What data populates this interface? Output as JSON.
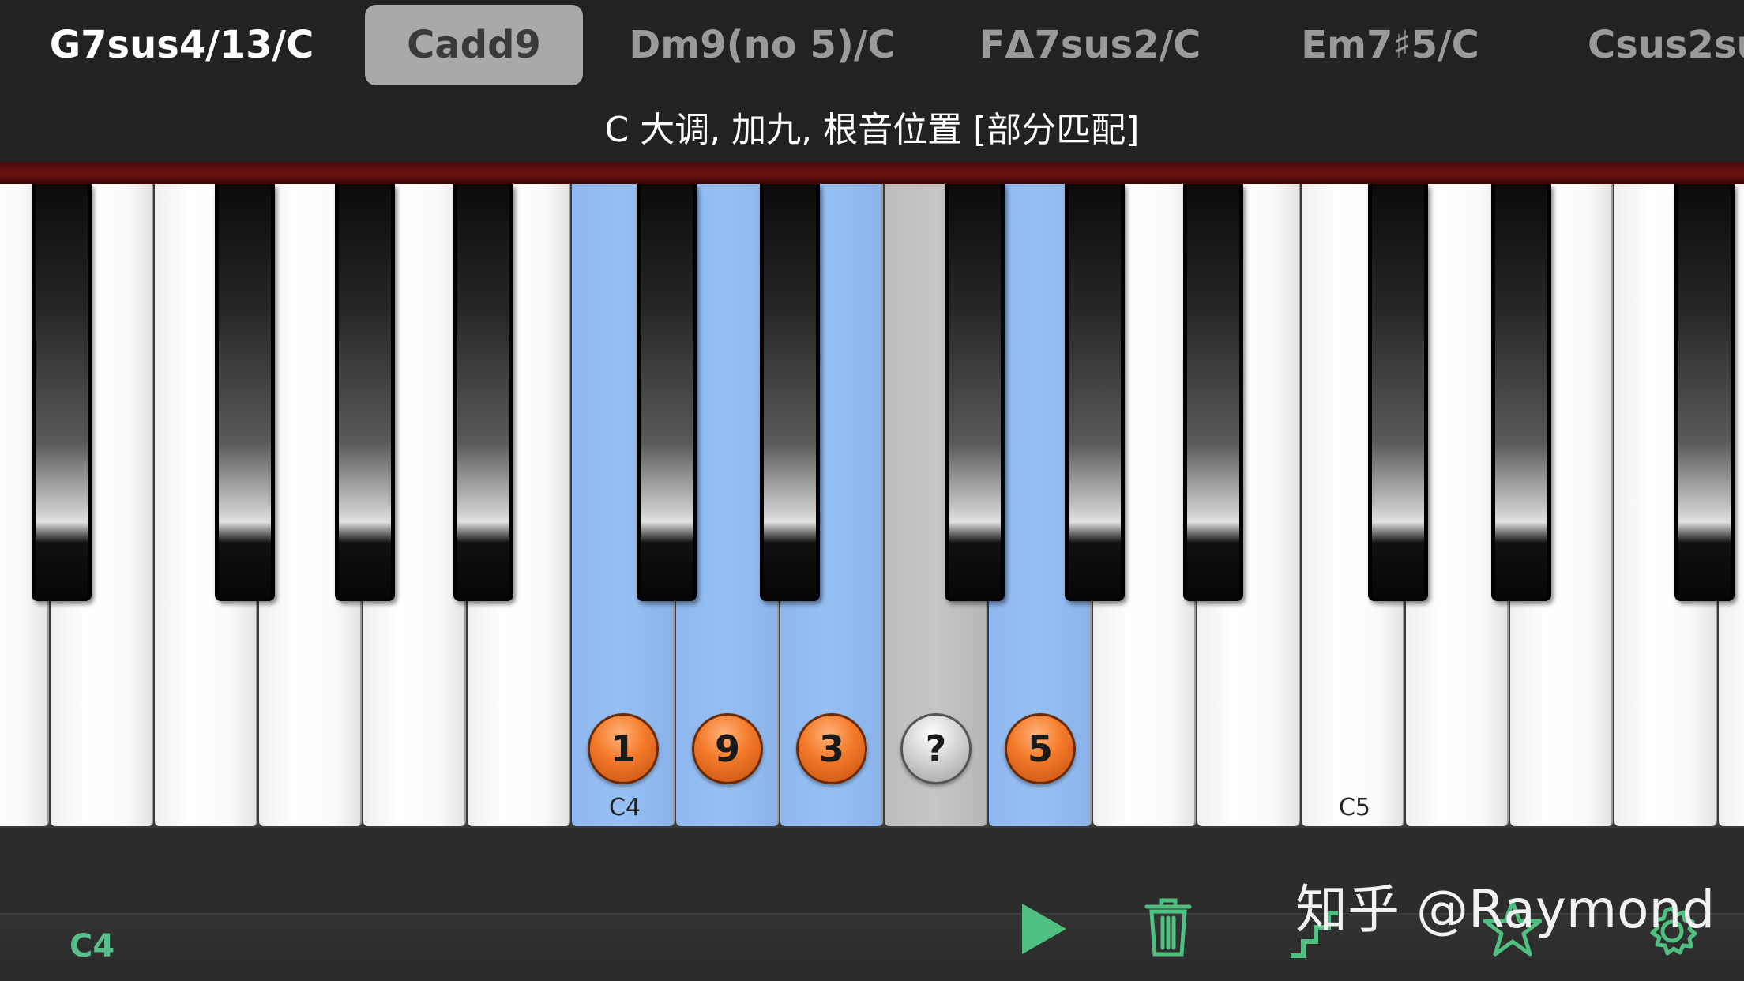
{
  "chord_tabs": [
    "G7sus4/13/C",
    "Cadd9",
    "Dm9(no 5)/C",
    "FΔ7sus2/C",
    "Em7♯5/C",
    "Csus2su"
  ],
  "selected_chord_index": 1,
  "chord_description": "C 大调, 加九, 根音位置 [部分匹配]",
  "keyboard": {
    "note_markers": [
      "1",
      "9",
      "3",
      "?",
      "5"
    ],
    "key_labels": {
      "c4": "C4",
      "c5": "C5"
    }
  },
  "toolbar": {
    "note_readout": "C4",
    "icons": [
      "play-icon",
      "trash-icon",
      "steps-icon",
      "star-icon",
      "gear-icon"
    ]
  },
  "watermark": "知乎 @Raymond",
  "colors": {
    "highlight_blue": "#8eb8ef",
    "unknown_gray": "#c0c0c0",
    "marker_orange": "#f47a2a",
    "accent_green": "#58c08a",
    "rail_red": "#6e1212"
  }
}
